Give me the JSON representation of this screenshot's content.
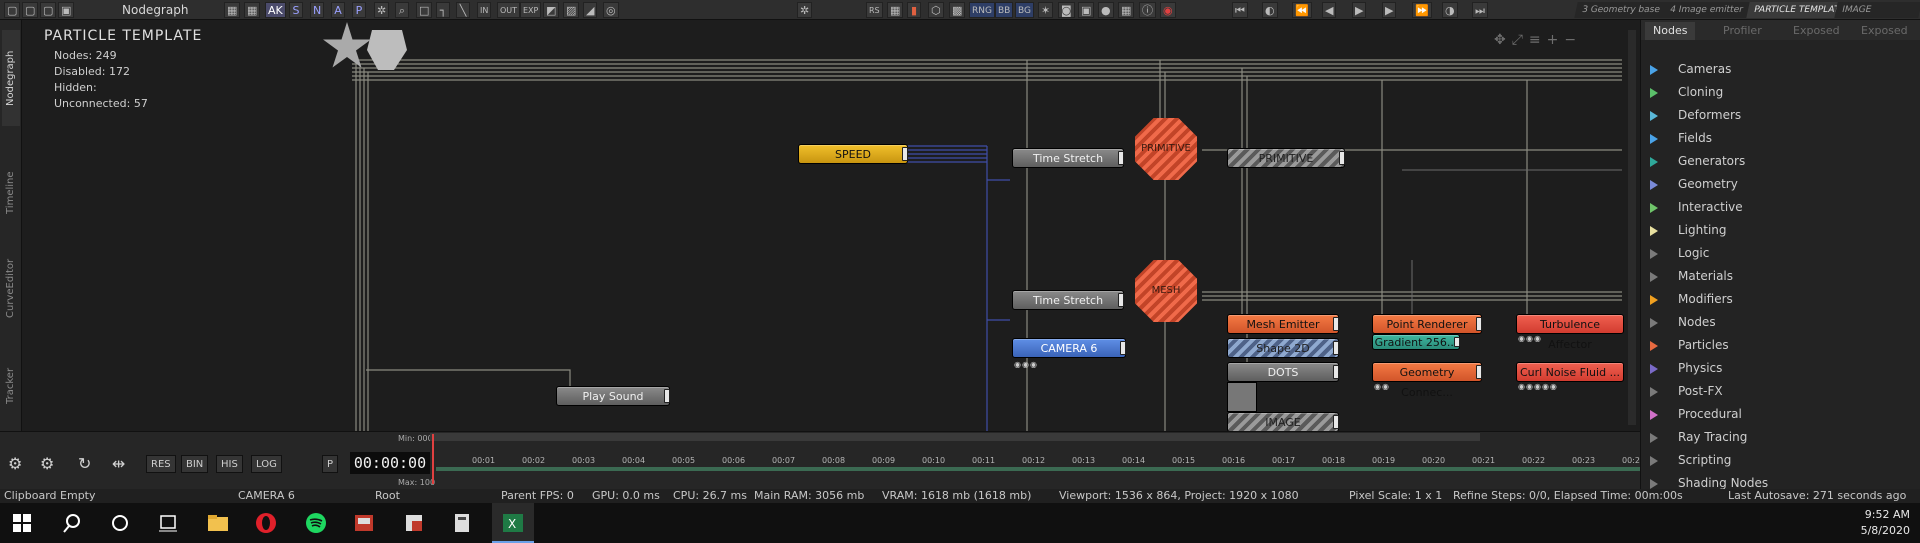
{
  "topbar": {
    "title": "Nodegraph",
    "snap_letters": [
      "AK",
      "S",
      "N",
      "A",
      "P"
    ],
    "labels": {
      "rs": "RS",
      "rng": "RNG",
      "bb": "BB",
      "bg": "BG",
      "in": "IN",
      "out": "OUT",
      "exp": "EXP"
    },
    "tabs": [
      "3 Geometry base",
      "4 Image emitter",
      "PARTICLE TEMPLATE",
      "IMAGE PARTICLE"
    ],
    "playback_icons": [
      "skip-start-icon",
      "loop-icon",
      "rewind-icon",
      "step-back-icon",
      "play-icon",
      "step-forward-icon",
      "fast-forward-icon",
      "loop-forward-icon",
      "skip-end-icon"
    ]
  },
  "sidebar_tabs": [
    "Nodegraph",
    "Timeline",
    "CurveEditor",
    "Tracker"
  ],
  "stats": {
    "title": "PARTICLE TEMPLATE",
    "nodes": "Nodes:  249",
    "disabled": "Disabled:  172",
    "hidden": "Hidden:",
    "unconnected": "Unconnected:  57"
  },
  "nodes": {
    "speed": "SPEED",
    "time_stretch_1": "Time  Stretch",
    "time_stretch_2": "Time  Stretch",
    "camera": "CAMERA  6",
    "play_sound": "Play  Sound",
    "primitive": "PRIMITIVE",
    "primitive_hatched": "PRIMITIVE",
    "mesh_hex": "MESH",
    "mesh_emitter": "Mesh  Emitter",
    "shape": "Shape  2D",
    "dots": "DOTS",
    "image": "IMAGE",
    "point_renderer": "Point  Renderer",
    "gradient": "Gradient  256...",
    "geometry_connector": "Geometry  Connec...",
    "turbulence": "Turbulence  Affector",
    "curl_noise": "Curl  Noise  Fluid  ..."
  },
  "right_panel": {
    "tabs": [
      "Nodes",
      "Profiler",
      "Exposed",
      "Exposed"
    ],
    "categories": [
      {
        "label": "Cameras",
        "color": "#4aa3e8"
      },
      {
        "label": "Cloning",
        "color": "#5bbf6a"
      },
      {
        "label": "Deformers",
        "color": "#5ab8d8"
      },
      {
        "label": "Fields",
        "color": "#4aa3e8"
      },
      {
        "label": "Generators",
        "color": "#2fa89a"
      },
      {
        "label": "Geometry",
        "color": "#7a8ad8"
      },
      {
        "label": "Interactive",
        "color": "#6fc46a"
      },
      {
        "label": "Lighting",
        "color": "#e8e0a0"
      },
      {
        "label": "Logic",
        "color": "#7a7a7a"
      },
      {
        "label": "Materials",
        "color": "#7a7a7a"
      },
      {
        "label": "Modifiers",
        "color": "#f0a020"
      },
      {
        "label": "Nodes",
        "color": "#7a7a7a"
      },
      {
        "label": "Particles",
        "color": "#e86a40"
      },
      {
        "label": "Physics",
        "color": "#7a6ac8"
      },
      {
        "label": "Post-FX",
        "color": "#7a7a7a"
      },
      {
        "label": "Procedural",
        "color": "#d070c8"
      },
      {
        "label": "Ray Tracing",
        "color": "#7a7a7a"
      },
      {
        "label": "Scripting",
        "color": "#7a7a7a"
      },
      {
        "label": "Shading Nodes",
        "color": "#7a7a7a"
      }
    ]
  },
  "timeline": {
    "buttons": [
      "RES",
      "BIN",
      "HIS",
      "LOG"
    ],
    "p_label": "P",
    "timecode": "00:00:00",
    "min_label": "Min: 000",
    "max_label": "Max: 100",
    "ticks": [
      "00:01",
      "00:02",
      "00:03",
      "00:04",
      "00:05",
      "00:06",
      "00:07",
      "00:08",
      "00:09",
      "00:10",
      "00:11",
      "00:12",
      "00:13",
      "00:14",
      "00:15",
      "00:16",
      "00:17",
      "00:18",
      "00:19",
      "00:20",
      "00:21",
      "00:22",
      "00:23",
      "00:2"
    ]
  },
  "statusbar": {
    "clipboard": "Clipboard Empty",
    "camera": "CAMERA 6",
    "root": "Root",
    "parent_fps": "Parent FPS: 0",
    "gpu": "GPU: 0.0 ms",
    "cpu": "CPU: 26.7 ms",
    "main_ram": "Main RAM: 3056 mb",
    "vram": "VRAM: 1618 mb (1618 mb)",
    "viewport": "Viewport: 1536 x 864, Project: 1920 x 1080",
    "pixel_scale": "Pixel Scale: 1 x 1",
    "refine": "Refine Steps: 0/0, Elapsed Time: 00m:00s",
    "autosave": "Last Autosave: 271 seconds ago"
  },
  "taskbar": {
    "time": "9:52 AM",
    "date": "5/8/2020"
  }
}
